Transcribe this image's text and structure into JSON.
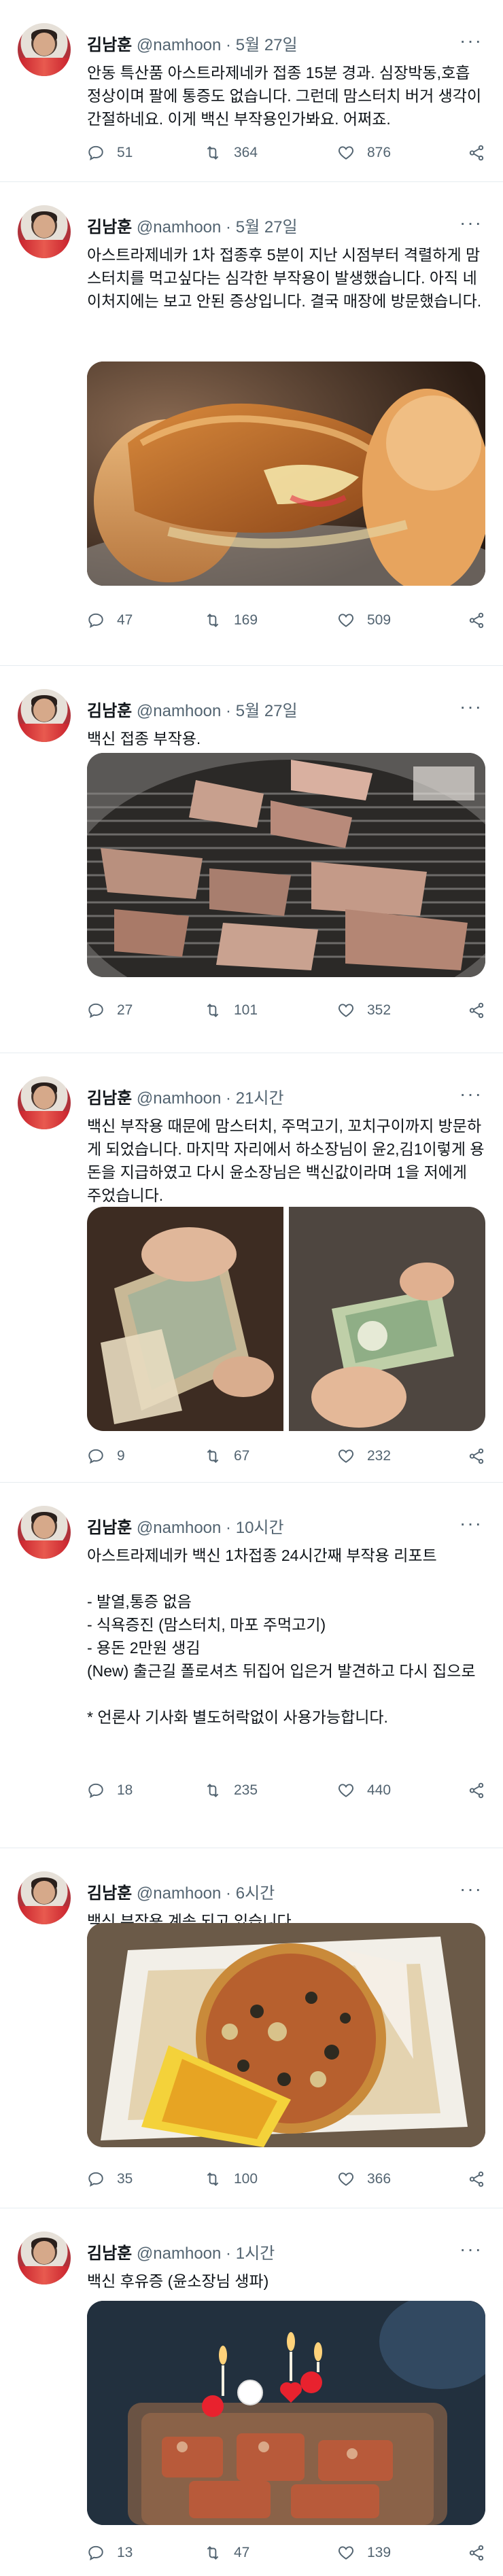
{
  "tweets": [
    {
      "name": "김남훈",
      "handle": "@namhoon",
      "time": "5월 27일",
      "text": [
        "안동 특산품 아스트라제네카 접종 15분 경과. 심장박동,호흡 정상이며 팔에 통증도 없습니다. 그런데 맘스터치 버거 생각이 간절하네요. 이게 백신 부작용인가봐요. 어쩌죠."
      ],
      "replies": "51",
      "retweets": "364",
      "likes": "876"
    },
    {
      "name": "김남훈",
      "handle": "@namhoon",
      "time": "5월 27일",
      "text": [
        "아스트라제네카 1차 접종후 5분이 지난 시점부터 격렬하게 맘스터치를 먹고싶다는 심각한 부작용이 발생했습니다. 아직 네이처지에는 보고 안된 증상입니다. 결국 매장에 방문했습니다."
      ],
      "replies": "47",
      "retweets": "169",
      "likes": "509"
    },
    {
      "name": "김남훈",
      "handle": "@namhoon",
      "time": "5월 27일",
      "text": [
        "백신 접종 부작용."
      ],
      "replies": "27",
      "retweets": "101",
      "likes": "352"
    },
    {
      "name": "김남훈",
      "handle": "@namhoon",
      "time": "21시간",
      "text": [
        "백신 부작용 때문에 맘스터치, 주먹고기, 꼬치구이까지 방문하게 되었습니다. 마지막 자리에서 하소장님이 윤2,김1이렇게 용돈을 지급하였고 다시 윤소장님은 백신값이라며 1을 저에게 주었습니다."
      ],
      "replies": "9",
      "retweets": "67",
      "likes": "232"
    },
    {
      "name": "김남훈",
      "handle": "@namhoon",
      "time": "10시간",
      "text": [
        "아스트라제네카 백신 1차접종 24시간째 부작용 리포트",
        "",
        "- 발열,통증 없음",
        "- 식욕증진 (맘스터치, 마포 주먹고기)",
        "- 용돈 2만원 생김",
        "(New) 출근길 폴로셔츠 뒤집어 입은거 발견하고 다시 집으로",
        "",
        "* 언론사 기사화 별도허락없이 사용가능합니다."
      ],
      "replies": "18",
      "retweets": "235",
      "likes": "440"
    },
    {
      "name": "김남훈",
      "handle": "@namhoon",
      "time": "6시간",
      "text": [
        "백신 부작용 계속 되고 있습니다."
      ],
      "replies": "35",
      "retweets": "100",
      "likes": "366"
    },
    {
      "name": "김남훈",
      "handle": "@namhoon",
      "time": "1시간",
      "text": [
        "백신 후유증 (윤소장님 생파)"
      ],
      "replies": "13",
      "retweets": "47",
      "likes": "139"
    }
  ],
  "ui": {
    "dot": "·",
    "more": "···"
  },
  "colors": {
    "text": "#0f1419",
    "secondary": "#536471",
    "divider": "#e6ecf0"
  },
  "icons": {
    "reply": "reply-icon",
    "retweet": "retweet-icon",
    "like": "heart-icon",
    "share": "share-icon",
    "more": "more-icon"
  }
}
